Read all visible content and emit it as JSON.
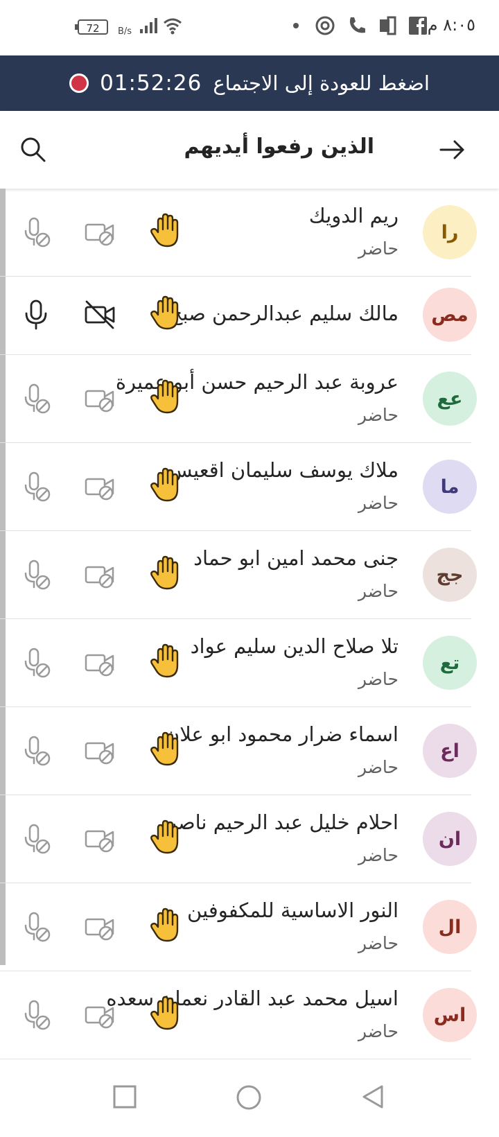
{
  "status_bar": {
    "clock": "٨:٠٥ م",
    "battery": "72",
    "net_speed": "B/s"
  },
  "banner": {
    "label": "اضغط للعودة إلى الاجتماع",
    "timer": "01:52:26"
  },
  "header": {
    "title": "الذين رفعوا أيديهم"
  },
  "participants": [
    {
      "initials": "را",
      "name": "ريم الدويك",
      "status": "حاضر",
      "avatar_bg": "#fcefc3",
      "avatar_fg": "#8a5a00",
      "muted": true
    },
    {
      "initials": "مص",
      "name": "مالك سليم عبدالرحمن صبح",
      "status": "",
      "avatar_bg": "#fbdcd8",
      "avatar_fg": "#8a2b1f",
      "muted": false
    },
    {
      "initials": "عع",
      "name": "عروبة عبد الرحيم حسن أبو عميرة",
      "status": "حاضر",
      "avatar_bg": "#d6f0df",
      "avatar_fg": "#1e6b3c",
      "muted": true
    },
    {
      "initials": "ما",
      "name": "ملاك يوسف سليمان اقعيس",
      "status": "حاضر",
      "avatar_bg": "#dedbf2",
      "avatar_fg": "#3f3a7a",
      "muted": true
    },
    {
      "initials": "جج",
      "name": "جنى محمد امين ابو حماد",
      "status": "حاضر",
      "avatar_bg": "#ece1dc",
      "avatar_fg": "#5e3d30",
      "muted": true
    },
    {
      "initials": "تع",
      "name": "تلا صلاح الدين سليم عواد",
      "status": "حاضر",
      "avatar_bg": "#d6f0df",
      "avatar_fg": "#1e6b3c",
      "muted": true
    },
    {
      "initials": "اع",
      "name": "اسماء ضرار محمود ابو علان",
      "status": "حاضر",
      "avatar_bg": "#ecdbe8",
      "avatar_fg": "#6b2b5c",
      "muted": true
    },
    {
      "initials": "ان",
      "name": "احلام خليل عبد الرحيم ناصر",
      "status": "حاضر",
      "avatar_bg": "#ecdbe8",
      "avatar_fg": "#6b2b5c",
      "muted": true
    },
    {
      "initials": "ال",
      "name": "النور الاساسية للمكفوفين",
      "status": "حاضر",
      "avatar_bg": "#fbdcd8",
      "avatar_fg": "#8a2b1f",
      "muted": true
    },
    {
      "initials": "اس",
      "name": "اسيل محمد عبد القادر نعمان سعده",
      "status": "حاضر",
      "avatar_bg": "#fbdcd8",
      "avatar_fg": "#8a2b1f",
      "muted": true
    }
  ],
  "icons": {
    "hand": "raised-hand-icon",
    "camera": "camera-off-icon",
    "mic": "mic-off-icon"
  }
}
